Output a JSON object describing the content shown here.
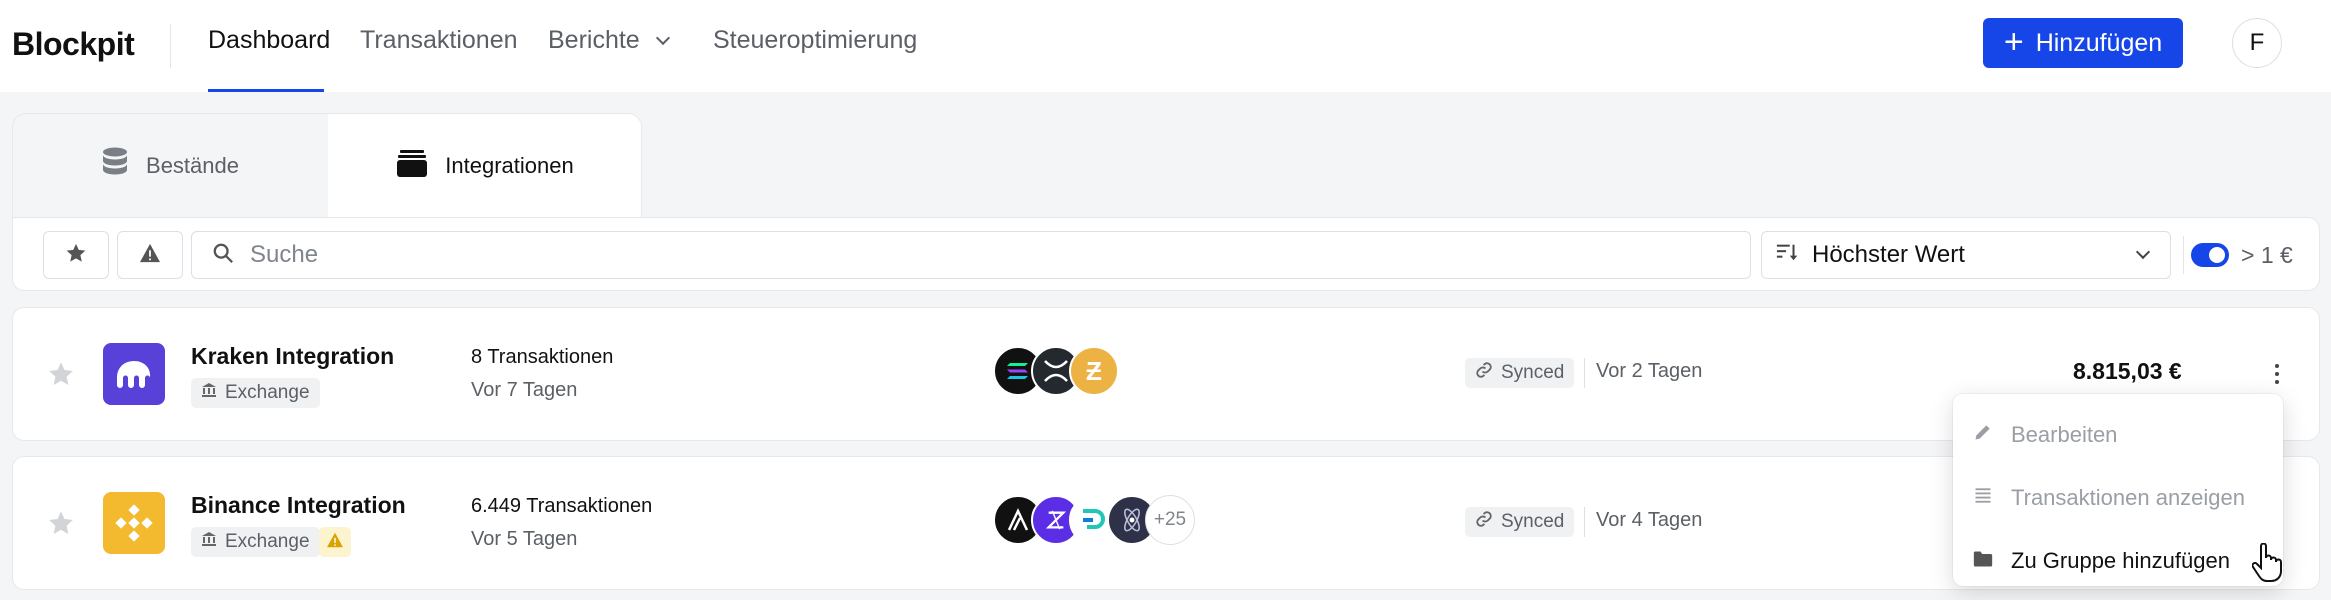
{
  "header": {
    "logo": "Blockpit",
    "nav": [
      {
        "label": "Dashboard",
        "active": true
      },
      {
        "label": "Transaktionen",
        "active": false
      },
      {
        "label": "Berichte",
        "active": false
      },
      {
        "label": "Steueroptimierung",
        "active": false
      }
    ],
    "add_button": "Hinzufügen",
    "avatar_initial": "F"
  },
  "tabs": [
    {
      "label": "Bestände",
      "icon": "database-icon",
      "selected": false
    },
    {
      "label": "Integrationen",
      "icon": "wallet-icon",
      "selected": true
    }
  ],
  "toolbar": {
    "search_placeholder": "Suche",
    "sort_label": "Höchster Wert",
    "threshold_label": "> 1 €",
    "threshold_toggle_on": true
  },
  "integrations": [
    {
      "name": "Kraken Integration",
      "type": "Exchange",
      "warning": false,
      "tx_count": "8 Transaktionen",
      "tx_date": "Vor 7 Tagen",
      "coins": [
        "solana",
        "xrp",
        "zcash"
      ],
      "more_coins": "",
      "sync_status": "Synced",
      "sync_time": "Vor 2 Tagen",
      "value": "8.815,03 €"
    },
    {
      "name": "Binance Integration",
      "type": "Exchange",
      "warning": true,
      "tx_count": "6.449 Transaktionen",
      "tx_date": "Vor 5 Tagen",
      "coins": [
        "algorand",
        "zilliqa",
        "dash",
        "cosmos"
      ],
      "more_coins": "+25",
      "sync_status": "Synced",
      "sync_time": "Vor 4 Tagen",
      "value": ""
    }
  ],
  "context_menu": {
    "items": [
      {
        "label": "Bearbeiten",
        "icon": "pencil-icon",
        "enabled": false
      },
      {
        "label": "Transaktionen anzeigen",
        "icon": "list-icon",
        "enabled": false
      },
      {
        "label": "Zu Gruppe hinzufügen",
        "icon": "folder-icon",
        "enabled": true
      }
    ]
  },
  "colors": {
    "accent": "#1746e8",
    "kraken": "#5741d9",
    "binance": "#f3ba2f"
  }
}
